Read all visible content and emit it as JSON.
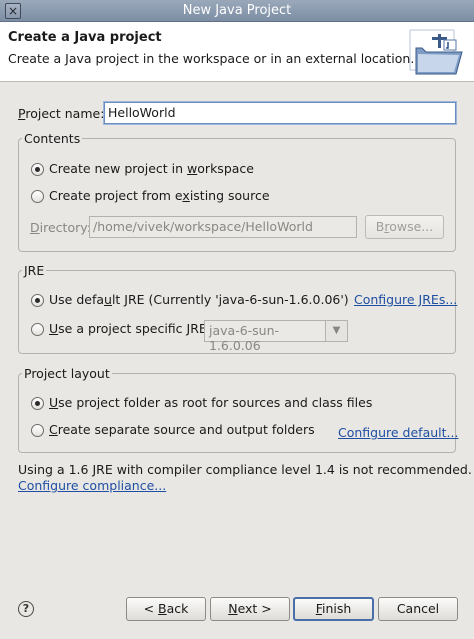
{
  "window": {
    "title": "New Java Project",
    "close_glyph": "×"
  },
  "header": {
    "title": "Create a Java project",
    "description": "Create a Java project in the workspace or in an external location.",
    "icon": "new-java-project-wizard-icon"
  },
  "project_name": {
    "label_pre": "P",
    "label_rest": "roject name:",
    "value": "HelloWorld"
  },
  "contents": {
    "title": "Contents",
    "option_workspace": {
      "pre": "Create new project in ",
      "u": "w",
      "post": "orkspace",
      "selected": true
    },
    "option_existing": {
      "pre": "Create project from e",
      "u": "x",
      "post": "isting source",
      "selected": false
    },
    "directory": {
      "label_pre": "",
      "label_u": "D",
      "label_post": "irectory:",
      "value": "/home/vivek/workspace/HelloWorld"
    },
    "browse": {
      "label_pre": "B",
      "label_u": "r",
      "label_post": "owse..."
    }
  },
  "jre": {
    "title": "JRE",
    "option_default": {
      "pre": "Use defa",
      "u": "u",
      "post": "lt JRE (Currently 'java-6-sun-1.6.0.06')",
      "selected": true
    },
    "configure_link": "Configure JREs...",
    "option_specific": {
      "pre": "",
      "u": "U",
      "post": "se a project specific JRE:",
      "selected": false
    },
    "specific_value": "java-6-sun-1.6.0.06",
    "combo_arrow": "▼"
  },
  "layout": {
    "title": "Project layout",
    "option_root": {
      "pre": "",
      "u": "U",
      "post": "se project folder as root for sources and class files",
      "selected": true
    },
    "option_separate": {
      "pre": "",
      "u": "C",
      "post": "reate separate source and output folders",
      "selected": false
    },
    "configure_link": "Configure default..."
  },
  "warning": {
    "text": "Using a 1.6 JRE with compiler compliance level 1.4 is not recommended.",
    "link": "Configure compliance..."
  },
  "buttons": {
    "help": "?",
    "back": {
      "pre": "< ",
      "u": "B",
      "post": "ack"
    },
    "next": {
      "pre": "",
      "u": "N",
      "post": "ext >"
    },
    "finish": {
      "pre": "",
      "u": "F",
      "post": "inish"
    },
    "cancel": "Cancel"
  }
}
